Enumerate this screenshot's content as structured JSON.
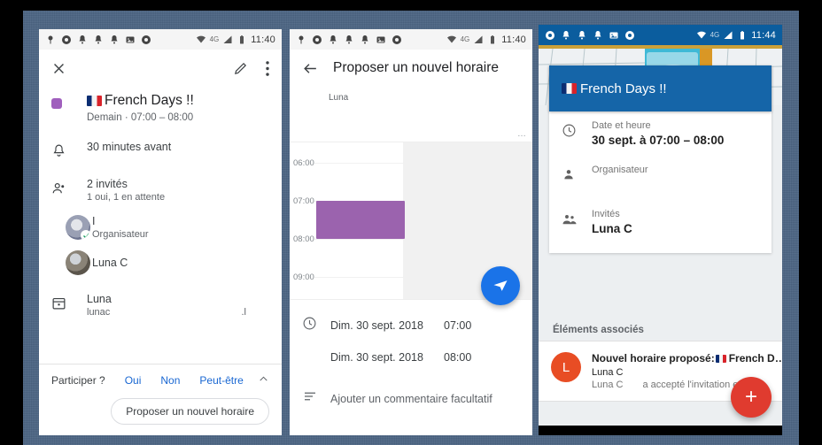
{
  "meta": {
    "accent_blue": "#1a73e8",
    "accent_purple": "#9b63ae",
    "accent_red": "#e03b2f",
    "header_blue": "#1565a8",
    "backdrop": "#4c6584"
  },
  "panel1": {
    "statusbar": {
      "icons": [
        "location-icon",
        "chrome-icon",
        "bell-icon",
        "bell-icon",
        "bell-icon",
        "image-icon",
        "chrome-icon"
      ],
      "wifi": "wifi-icon",
      "network": "4G",
      "signal": "signal-icon",
      "battery": "battery-icon",
      "time": "11:40"
    },
    "appbar": {
      "close": "close-icon",
      "edit": "pencil-icon",
      "more": "more-vert-icon"
    },
    "event": {
      "title": "French Days !!",
      "flag": "fr-flag-icon",
      "subtitle": "Demain  ·  07:00 – 08:00",
      "color_swatch": "#a05fbd"
    },
    "reminder": {
      "icon": "bell-icon",
      "text": "30 minutes avant"
    },
    "guests": {
      "icon": "people-icon",
      "count_text": "2 invités",
      "status_text": "1 oui, 1 en attente",
      "list": [
        {
          "avatar": "avatar-organizer",
          "name": "I",
          "role": "Organisateur",
          "accepted": true
        },
        {
          "avatar": "avatar-luna",
          "name": "Luna C",
          "role": "",
          "accepted": false
        }
      ]
    },
    "calendar": {
      "icon": "calendar-icon",
      "name": "Luna",
      "email": "lunac",
      "email_tail": ".l"
    },
    "footer": {
      "question": "Participer ?",
      "options": [
        "Oui",
        "Non",
        "Peut-être"
      ],
      "chevron": "chevron-up-icon",
      "propose_button": "Proposer un nouvel horaire"
    }
  },
  "panel2": {
    "statusbar": {
      "icons": [
        "location-icon",
        "chrome-icon",
        "bell-icon",
        "bell-icon",
        "bell-icon",
        "image-icon",
        "chrome-icon"
      ],
      "network": "4G",
      "time": "11:40"
    },
    "appbar": {
      "back": "arrow-back-icon",
      "title": "Proposer un nouvel horaire"
    },
    "heads": [
      {
        "avatar": "avatar-luna",
        "label": "Luna"
      },
      {
        "avatar": "avatar-other",
        "label": ""
      }
    ],
    "grid": {
      "hours": [
        "06:00",
        "07:00",
        "08:00",
        "09:00"
      ],
      "overflow_dots": "…",
      "event": {
        "start": "07:00",
        "end": "08:00",
        "color": "#9b63ae"
      }
    },
    "send_fab": "send-icon",
    "datetime_rows": [
      {
        "icon": "clock-icon",
        "date": "Dim. 30 sept. 2018",
        "time": "07:00"
      },
      {
        "icon": "",
        "date": "Dim. 30 sept. 2018",
        "time": "08:00"
      }
    ],
    "comment": {
      "icon": "notes-icon",
      "placeholder": "Ajouter un commentaire facultatif"
    }
  },
  "panel3": {
    "statusbar": {
      "icons": [
        "chrome-icon",
        "bell-icon",
        "bell-icon",
        "bell-icon",
        "image-icon",
        "chrome-icon"
      ],
      "network": "4G",
      "time": "11:44"
    },
    "hero_actions": {
      "close": "close-icon",
      "delete": "trash-icon",
      "confirm": "check-icon",
      "more": "more-vert-icon"
    },
    "title": {
      "flag": "fr-flag-icon",
      "text": "French Days !!"
    },
    "details": [
      {
        "icon": "clock-icon",
        "label": "Date et heure",
        "value": "30 sept. à 07:00 – 08:00"
      },
      {
        "icon": "person-icon",
        "label": "Organisateur",
        "value": ""
      },
      {
        "icon": "people-icon",
        "label": "Invités",
        "value": "Luna C"
      }
    ],
    "section_label": "Éléments associés",
    "associated": {
      "badge_letter": "L",
      "badge_color": "#e84d24",
      "title_prefix": "Nouvel horaire proposé: ",
      "flag": "fr-flag-icon",
      "title_suffix": "French D…",
      "line2": "Luna C",
      "line3_a": "Luna C",
      "line3_b": "a accepté l'invitation en"
    },
    "fab": {
      "icon": "plus-icon",
      "color": "#e03b2f"
    }
  }
}
